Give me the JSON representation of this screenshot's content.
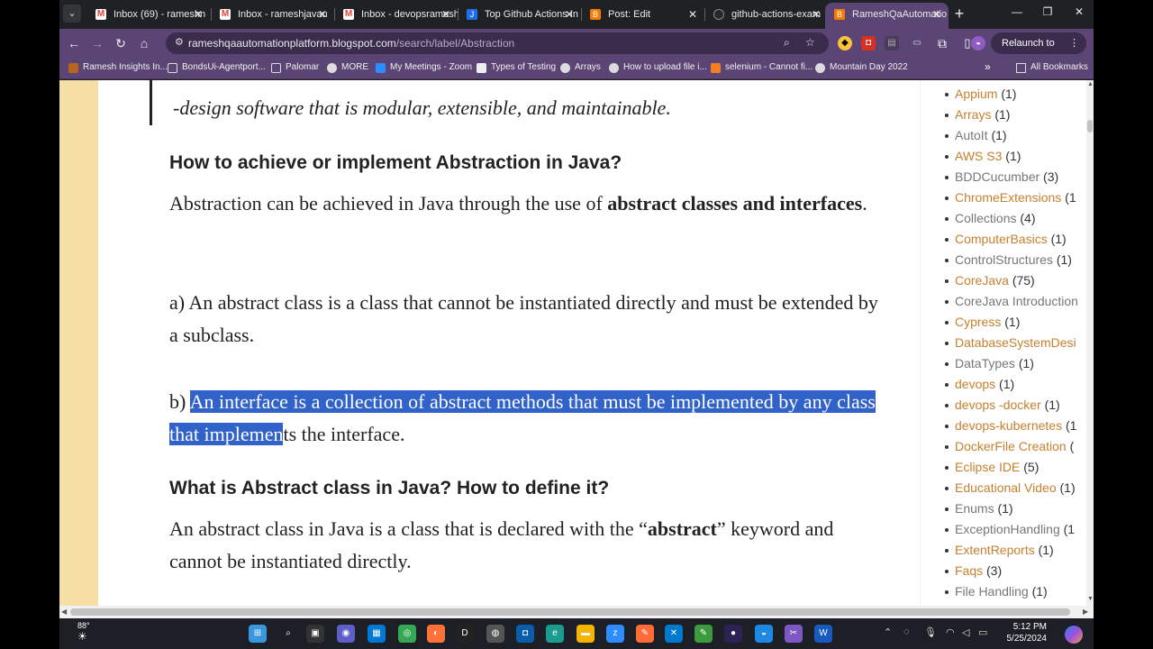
{
  "tabs": [
    {
      "title": "Inbox (69) - rameshn",
      "favicon_color": "#ea4335",
      "favicon": "M"
    },
    {
      "title": "Inbox - rameshjavau",
      "favicon_color": "#ea4335",
      "favicon": "M"
    },
    {
      "title": "Inbox - devopsramesh",
      "favicon_color": "#ea4335",
      "favicon": "M"
    },
    {
      "title": "Top Github Actions In",
      "favicon_color": "#1f6feb",
      "favicon": "J"
    },
    {
      "title": "Post: Edit",
      "favicon_color": "#f57c00",
      "favicon": "B"
    },
    {
      "title": "github-actions-exam",
      "favicon_color": "#24292e",
      "favicon": "G"
    },
    {
      "title": "RameshQaAutomatio",
      "favicon_color": "#f57c00",
      "favicon": "B"
    }
  ],
  "url": {
    "host": "rameshqaautomationplatform.blogspot.com",
    "path": "/search/label/Abstraction"
  },
  "relaunch_label": "Relaunch to update",
  "bookmarks": [
    {
      "label": "Ramesh Insights In...",
      "color": "#b5651d"
    },
    {
      "label": "BondsUi-Agentport...",
      "color": "#6d5c7e"
    },
    {
      "label": "Palomar",
      "color": "#6d5c7e"
    },
    {
      "label": "MORE",
      "color": "#444"
    },
    {
      "label": "My Meetings - Zoom",
      "color": "#2d8cff"
    },
    {
      "label": "Types of Testing",
      "color": "#eee"
    },
    {
      "label": "Arrays",
      "color": "#444"
    },
    {
      "label": "How to upload file i...",
      "color": "#444"
    },
    {
      "label": "selenium - Cannot fi...",
      "color": "#f48024"
    },
    {
      "label": "Mountain Day 2022",
      "color": "#444"
    }
  ],
  "all_bookmarks": "All Bookmarks",
  "article": {
    "quote": "-design software that is modular, extensible, and maintainable.",
    "heading1": "How to achieve or implement Abstraction in Java?",
    "p1_text": "Abstraction can be achieved in Java through the use of ",
    "p1_bold": "abstract classes and interfaces",
    "p1_end": ".",
    "p2": "a) An abstract class is a class that cannot be instantiated directly and must be extended by a subclass.",
    "p3_prefix": "b) ",
    "p3_selected": "An interface is a collection of abstract methods that must be implemented by any class that implemen",
    "p3_rest": "ts the interface.",
    "heading2": "What is Abstract class in Java? How to define it?",
    "p4_text": "An abstract class in Java is a class that is declared with the “",
    "p4_bold": "abstract",
    "p4_end": "” keyword and cannot be instantiated directly."
  },
  "labels": [
    {
      "name": "Appium",
      "count": "(1)",
      "color": "#c6802e"
    },
    {
      "name": "Arrays",
      "count": "(1)",
      "color": "#c6802e"
    },
    {
      "name": "AutoIt",
      "count": "(1)",
      "color": "#777"
    },
    {
      "name": "AWS S3",
      "count": "(1)",
      "color": "#c6802e"
    },
    {
      "name": "BDDCucumber",
      "count": "(3)",
      "color": "#777"
    },
    {
      "name": "ChromeExtensions",
      "count": "(1",
      "color": "#c6802e"
    },
    {
      "name": "Collections",
      "count": "(4)",
      "color": "#777"
    },
    {
      "name": "ComputerBasics",
      "count": "(1)",
      "color": "#c6802e"
    },
    {
      "name": "ControlStructures",
      "count": "(1)",
      "color": "#777"
    },
    {
      "name": "CoreJava",
      "count": "(75)",
      "color": "#c6802e"
    },
    {
      "name": "CoreJava Introduction",
      "count": "",
      "color": "#777"
    },
    {
      "name": "Cypress",
      "count": "(1)",
      "color": "#c6802e"
    },
    {
      "name": "DatabaseSystemDesi",
      "count": "",
      "color": "#c6802e"
    },
    {
      "name": "DataTypes",
      "count": "(1)",
      "color": "#777"
    },
    {
      "name": "devops",
      "count": "(1)",
      "color": "#c6802e"
    },
    {
      "name": "devops -docker",
      "count": "(1)",
      "color": "#c6802e"
    },
    {
      "name": "devops-kubernetes",
      "count": "(1",
      "color": "#c6802e"
    },
    {
      "name": "DockerFile Creation",
      "count": "(",
      "color": "#c6802e"
    },
    {
      "name": "Eclipse IDE",
      "count": "(5)",
      "color": "#c6802e"
    },
    {
      "name": "Educational Video",
      "count": "(1)",
      "color": "#c6802e"
    },
    {
      "name": "Enums",
      "count": "(1)",
      "color": "#777"
    },
    {
      "name": "ExceptionHandling",
      "count": "(1",
      "color": "#777"
    },
    {
      "name": "ExtentReports",
      "count": "(1)",
      "color": "#c6802e"
    },
    {
      "name": "Faqs",
      "count": "(3)",
      "color": "#c6802e"
    },
    {
      "name": "File Handling",
      "count": "(1)",
      "color": "#777"
    }
  ],
  "taskbar": {
    "weather": "88°",
    "time": "5:12 PM",
    "date": "5/25/2024",
    "apps": [
      {
        "name": "start-icon",
        "color": "#3a96dd",
        "glyph": "⊞"
      },
      {
        "name": "search-icon",
        "color": "transparent",
        "glyph": "⌕"
      },
      {
        "name": "task-view-icon",
        "color": "#333",
        "glyph": "▣"
      },
      {
        "name": "chat-icon",
        "color": "#5b5fc7",
        "glyph": "◉"
      },
      {
        "name": "store-icon",
        "color": "#0078d4",
        "glyph": "▦"
      },
      {
        "name": "chrome-icon",
        "color": "#34a853",
        "glyph": "◎"
      },
      {
        "name": "firefox-icon",
        "color": "#ff7139",
        "glyph": "◐"
      },
      {
        "name": "dell-icon",
        "color": "#222",
        "glyph": "D"
      },
      {
        "name": "app-icon",
        "color": "#555",
        "glyph": "◍"
      },
      {
        "name": "photos-icon",
        "color": "#0a5cad",
        "glyph": "◘"
      },
      {
        "name": "edge-icon",
        "color": "#1a9c8f",
        "glyph": "e"
      },
      {
        "name": "explorer-icon",
        "color": "#f4b400",
        "glyph": "▬"
      },
      {
        "name": "zoom-icon",
        "color": "#2d8cff",
        "glyph": "z"
      },
      {
        "name": "postman-icon",
        "color": "#ff6c37",
        "glyph": "✎"
      },
      {
        "name": "vscode-icon",
        "color": "#007acc",
        "glyph": "✕"
      },
      {
        "name": "notepad-icon",
        "color": "#3c9b3c",
        "glyph": "✎"
      },
      {
        "name": "eclipse-icon",
        "color": "#2c2255",
        "glyph": "●"
      },
      {
        "name": "app2-icon",
        "color": "#1e88e5",
        "glyph": "◒"
      },
      {
        "name": "snipping-icon",
        "color": "#7e57c2",
        "glyph": "✂"
      },
      {
        "name": "word-icon",
        "color": "#185abd",
        "glyph": "W"
      }
    ]
  }
}
